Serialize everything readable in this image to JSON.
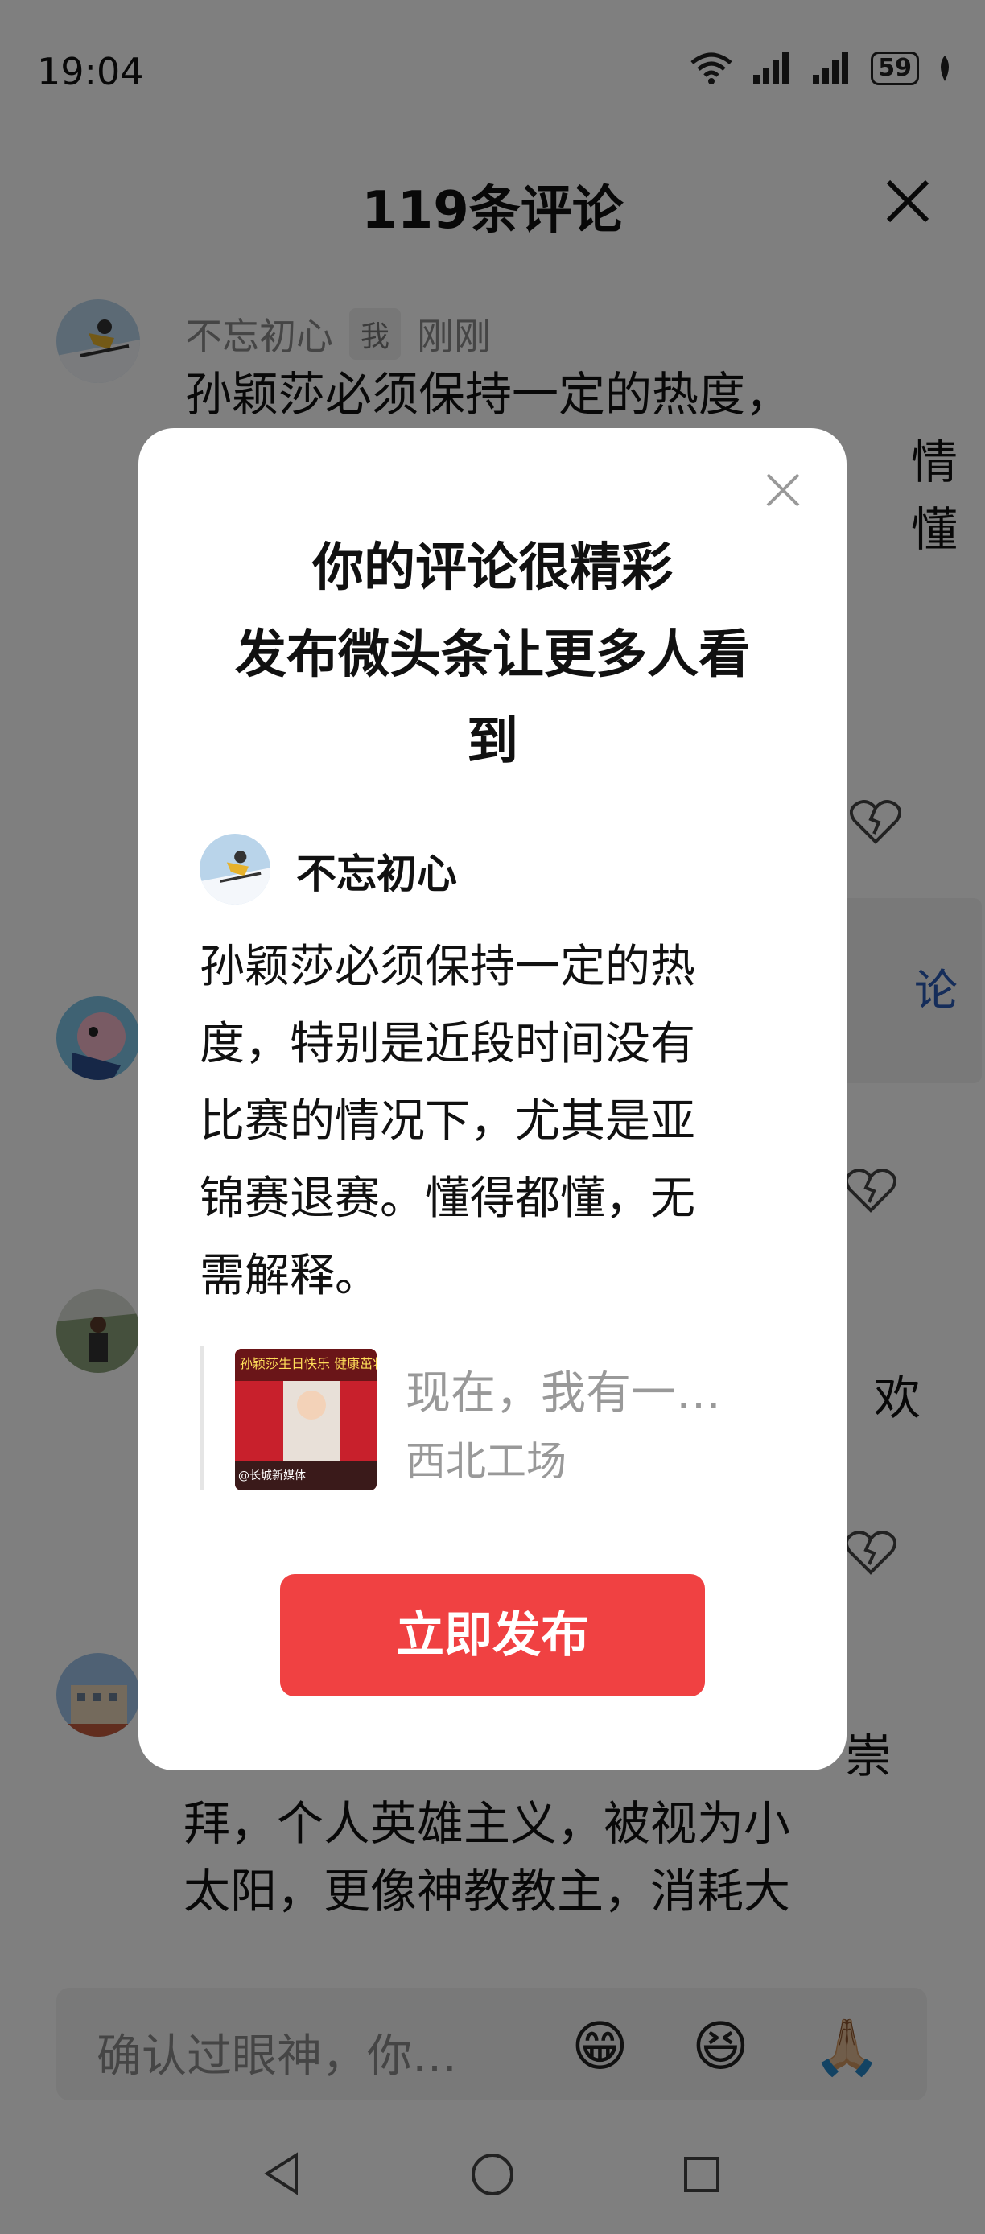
{
  "status_bar": {
    "time": "19:04",
    "battery": "59"
  },
  "sheet": {
    "title": "119条评论",
    "comments": [
      {
        "username": "不忘初心",
        "me_tag": "我",
        "time": "刚刚",
        "lines": [
          "孙颖莎必须保持一定的热度，",
          "情",
          "懂"
        ],
        "reply_link": "论"
      },
      {
        "partial": "欢"
      },
      {
        "lines": [
          "崇",
          "拜，个人英雄主义，被视为小",
          "太阳，更像神教教主，消耗大"
        ]
      }
    ]
  },
  "input": {
    "placeholder": "确认过眼神，你…",
    "emojis": [
      "😁",
      "😆",
      "🙏🏼"
    ]
  },
  "modal": {
    "title_lines": [
      "你的评论很精彩",
      "发布微头条让更多人看",
      "到"
    ],
    "username": "不忘初心",
    "comment_lines": [
      "孙颖莎必须保持一定的热",
      "度，特别是近段时间没有",
      "比赛的情况下，尤其是亚",
      "锦赛退赛。懂得都懂，无",
      "需解释。"
    ],
    "quote": {
      "title": "现在，我有一…",
      "source": "西北工场",
      "thumb_caption": "孙颖莎生日快乐 健康茁壮",
      "thumb_tag": "@长城新媒体"
    },
    "publish_label": "立即发布"
  },
  "colors": {
    "accent": "#f04142",
    "link": "#2a5ab5"
  }
}
